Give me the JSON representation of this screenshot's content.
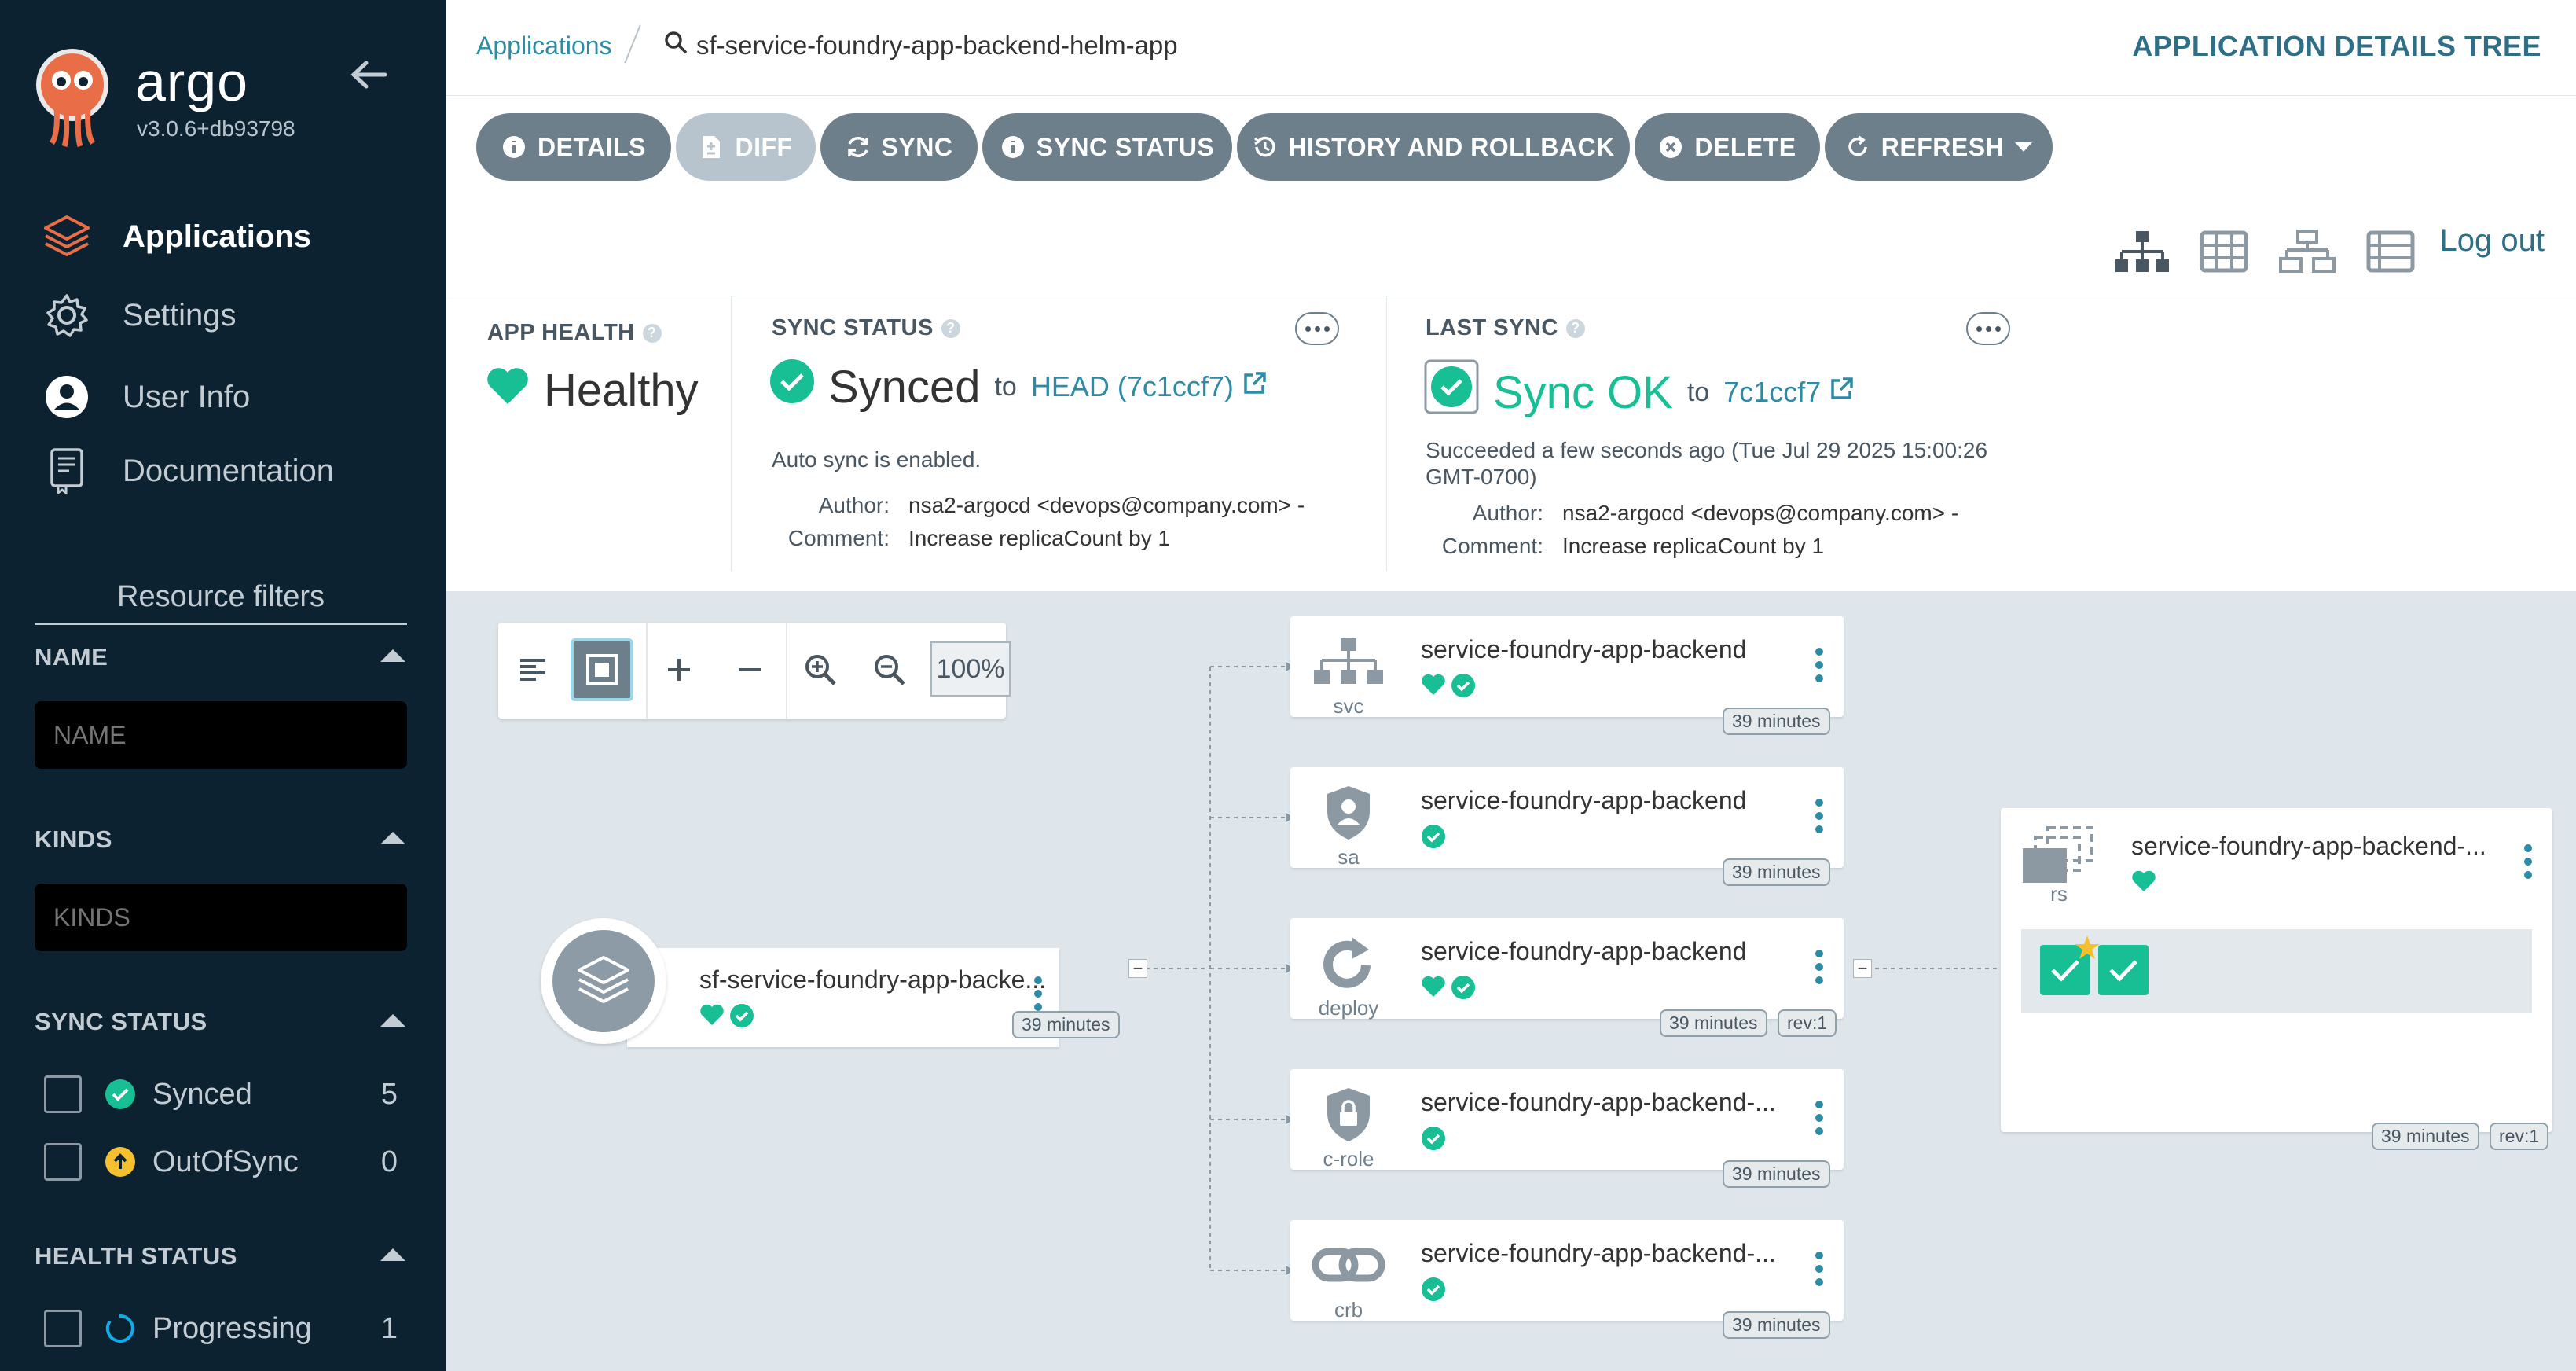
{
  "sidebar": {
    "app_name": "argo",
    "version": "v3.0.6+db93798",
    "nav": [
      {
        "label": "Applications",
        "icon": "layers-icon"
      },
      {
        "label": "Settings",
        "icon": "gear-icon"
      },
      {
        "label": "User Info",
        "icon": "user-icon"
      },
      {
        "label": "Documentation",
        "icon": "book-icon"
      }
    ],
    "filters_title": "Resource filters",
    "name_filter": {
      "label": "NAME",
      "placeholder": "NAME"
    },
    "kinds_filter": {
      "label": "KINDS",
      "placeholder": "KINDS"
    },
    "sync_status": {
      "label": "SYNC STATUS",
      "items": [
        {
          "label": "Synced",
          "count": "5"
        },
        {
          "label": "OutOfSync",
          "count": "0"
        }
      ]
    },
    "health_status": {
      "label": "HEALTH STATUS",
      "items": [
        {
          "label": "Progressing",
          "count": "1"
        }
      ]
    }
  },
  "header": {
    "breadcrumb_root": "Applications",
    "breadcrumb_current": "sf-service-foundry-app-backend-helm-app",
    "title": "APPLICATION DETAILS TREE"
  },
  "toolbar": {
    "details": "DETAILS",
    "diff": "DIFF",
    "sync": "SYNC",
    "sync_status": "SYNC STATUS",
    "history": "HISTORY AND ROLLBACK",
    "delete": "DELETE",
    "refresh": "REFRESH",
    "logout": "Log out"
  },
  "status": {
    "app_health": {
      "label": "APP HEALTH",
      "value": "Healthy"
    },
    "sync_status": {
      "label": "SYNC STATUS",
      "value": "Synced",
      "to": "to",
      "revision": "HEAD (7c1ccf7)",
      "auto_sync": "Auto sync is enabled.",
      "author_label": "Author:",
      "author": "nsa2-argocd <devops@company.com> -",
      "comment_label": "Comment:",
      "comment": "Increase replicaCount by 1"
    },
    "last_sync": {
      "label": "LAST SYNC",
      "value": "Sync OK",
      "to": "to",
      "revision": "7c1ccf7",
      "succeeded_line1": "Succeeded a few seconds ago (Tue Jul 29 2025 15:00:26",
      "succeeded_line2": "GMT-0700)",
      "author_label": "Author:",
      "author": "nsa2-argocd <devops@company.com> -",
      "comment_label": "Comment:",
      "comment": "Increase replicaCount by 1"
    }
  },
  "graph": {
    "zoom": "100%",
    "app": {
      "name": "sf-service-foundry-app-backe...",
      "age": "39 minutes"
    },
    "nodes": [
      {
        "kind": "svc",
        "name": "service-foundry-app-backend",
        "age": "39 minutes"
      },
      {
        "kind": "sa",
        "name": "service-foundry-app-backend",
        "age": "39 minutes"
      },
      {
        "kind": "deploy",
        "name": "service-foundry-app-backend",
        "age": "39 minutes",
        "rev": "rev:1"
      },
      {
        "kind": "c-role",
        "name": "service-foundry-app-backend-...",
        "age": "39 minutes"
      },
      {
        "kind": "crb",
        "name": "service-foundry-app-backend-...",
        "age": "39 minutes"
      }
    ],
    "rs": {
      "kind": "rs",
      "name": "service-foundry-app-backend-...",
      "age": "39 minutes",
      "rev": "rev:1"
    }
  },
  "colors": {
    "sidebar_bg": "#0d2231",
    "accent": "#2e8ba6",
    "healthy": "#18be94",
    "button": "#6d7f8b",
    "outofsync": "#f4c030",
    "progressing": "#0dadea"
  }
}
